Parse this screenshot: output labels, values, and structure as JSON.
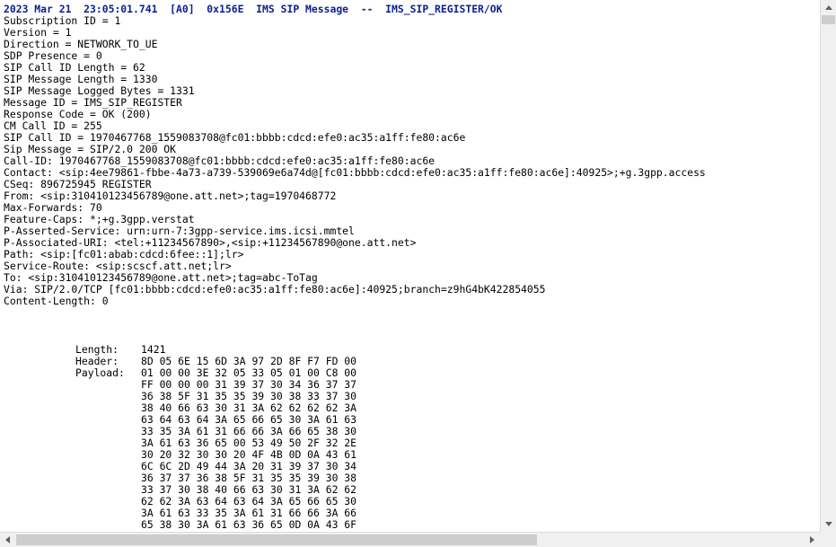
{
  "log": {
    "header": "2023 Mar 21  23:05:01.741  [A0]  0x156E  IMS SIP Message  --  IMS_SIP_REGISTER/OK",
    "lines": [
      "Subscription ID = 1",
      "Version = 1",
      "Direction = NETWORK_TO_UE",
      "SDP Presence = 0",
      "SIP Call ID Length = 62",
      "SIP Message Length = 1330",
      "SIP Message Logged Bytes = 1331",
      "Message ID = IMS_SIP_REGISTER",
      "Response Code = OK (200)",
      "CM Call ID = 255",
      "SIP Call ID = 1970467768_1559083708@fc01:bbbb:cdcd:efe0:ac35:a1ff:fe80:ac6e",
      "Sip Message = SIP/2.0 200 OK",
      "Call-ID: 1970467768_1559083708@fc01:bbbb:cdcd:efe0:ac35:a1ff:fe80:ac6e",
      "Contact: <sip:4ee79861-fbbe-4a73-a739-539069e6a74d@[fc01:bbbb:cdcd:efe0:ac35:a1ff:fe80:ac6e]:40925>;+g.3gpp.access",
      "CSeq: 896725945 REGISTER",
      "From: <sip:310410123456789@one.att.net>;tag=1970468772",
      "Max-Forwards: 70",
      "Feature-Caps: *;+g.3gpp.verstat",
      "P-Asserted-Service: urn:urn-7:3gpp-service.ims.icsi.mmtel",
      "P-Associated-URI: <tel:+11234567890>,<sip:+11234567890@one.att.net>",
      "Path: <sip:[fc01:abab:cdcd:6fee::1];lr>",
      "Service-Route: <sip:scscf.att.net;lr>",
      "To: <sip:310410123456789@one.att.net>;tag=abc-ToTag",
      "Via: SIP/2.0/TCP [fc01:bbbb:cdcd:efe0:ac35:a1ff:fe80:ac6e]:40925;branch=z9hG4bK422854055",
      "Content-Length: 0"
    ]
  },
  "hexdump": {
    "length_label": "Length:",
    "length_value": "1421",
    "header_label": "Header:",
    "header_bytes": "8D 05 6E 15 6D 3A 97 2D 8F F7 FD 00",
    "payload_label": "Payload:",
    "payload_rows": [
      "01 00 00 3E 32 05 33 05 01 00 C8 00",
      "FF 00 00 00 31 39 37 30 34 36 37 37",
      "36 38 5F 31 35 35 39 30 38 33 37 30",
      "38 40 66 63 30 31 3A 62 62 62 62 3A",
      "63 64 63 64 3A 65 66 65 30 3A 61 63",
      "33 35 3A 61 31 66 66 3A 66 65 38 30",
      "3A 61 63 36 65 00 53 49 50 2F 32 2E",
      "30 20 32 30 30 20 4F 4B 0D 0A 43 61",
      "6C 6C 2D 49 44 3A 20 31 39 37 30 34",
      "36 37 37 36 38 5F 31 35 35 39 30 38",
      "33 37 30 38 40 66 63 30 31 3A 62 62",
      "62 62 3A 63 64 63 64 3A 65 66 65 30",
      "3A 61 63 33 35 3A 61 31 66 66 3A 66",
      "65 38 30 3A 61 63 36 65 0D 0A 43 6F"
    ]
  },
  "scrollbars": {
    "vertical_up_icon": "triangle-up",
    "vertical_down_icon": "triangle-down",
    "horizontal_left_icon": "triangle-left",
    "horizontal_right_icon": "triangle-right"
  },
  "colors": {
    "header_text": "#0a1f8f",
    "body_text": "#000000",
    "scrollbar_track": "#f0f0f0",
    "scrollbar_thumb": "#cdcdcd"
  }
}
